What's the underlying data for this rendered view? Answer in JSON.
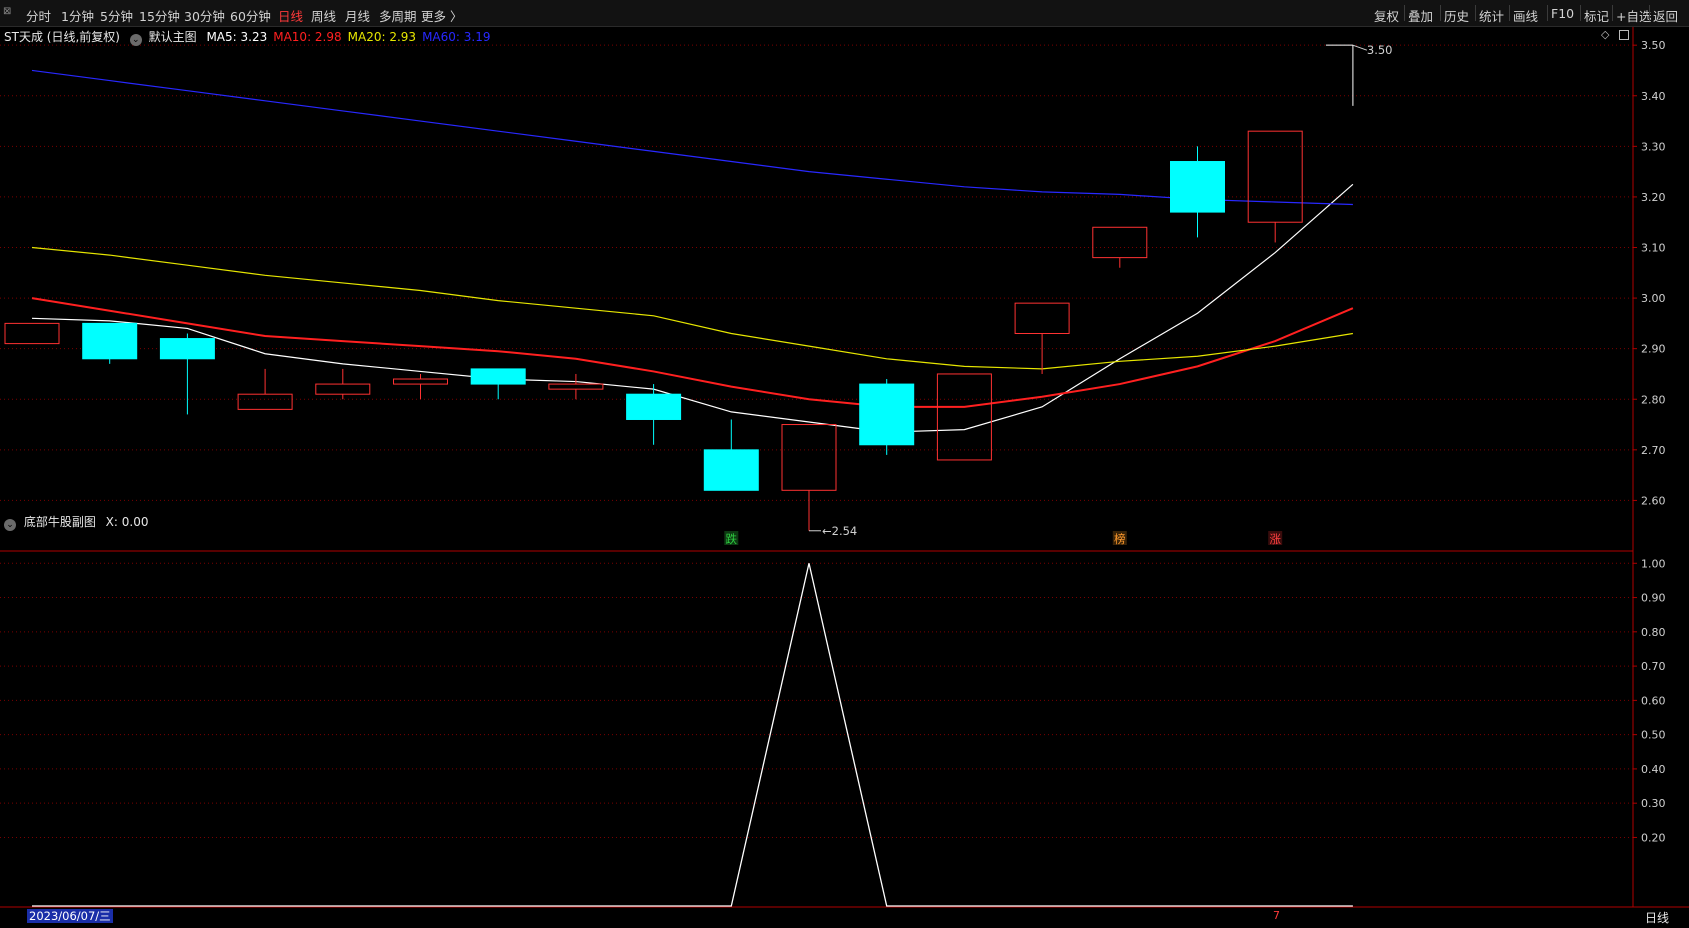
{
  "toolbar": {
    "left_items": [
      {
        "label": "分时",
        "active": false
      },
      {
        "label": "1分钟",
        "active": false
      },
      {
        "label": "5分钟",
        "active": false
      },
      {
        "label": "15分钟",
        "active": false
      },
      {
        "label": "30分钟",
        "active": false
      },
      {
        "label": "60分钟",
        "active": false
      },
      {
        "label": "日线",
        "active": true
      },
      {
        "label": "周线",
        "active": false
      },
      {
        "label": "月线",
        "active": false
      },
      {
        "label": "多周期",
        "active": false
      },
      {
        "label": "更多 〉",
        "active": false
      }
    ],
    "right_items": [
      "复权",
      "叠加",
      "历史",
      "统计",
      "画线",
      "F10",
      "标记",
      "+自选",
      "返回"
    ]
  },
  "main_chart": {
    "stock_title": "ST天成 (日线,前复权)",
    "template_label": "默认主图",
    "ma_legend": [
      {
        "label": "MA5: 3.23",
        "color": "#ffffff"
      },
      {
        "label": "MA10: 2.98",
        "color": "#ff2020"
      },
      {
        "label": "MA20: 2.93",
        "color": "#e6e600"
      },
      {
        "label": "MA60: 3.19",
        "color": "#2828ff"
      }
    ],
    "high_label": "3.50",
    "low_label": "2.54",
    "markers": [
      {
        "text": "跌",
        "color": "#2ecc40",
        "bg": "#0d3a12",
        "index": 9
      },
      {
        "text": "榜",
        "color": "#ff9a2e",
        "bg": "#3a2408",
        "index": 14
      },
      {
        "text": "涨",
        "color": "#ff4040",
        "bg": "#3a0c0c",
        "index": 16
      }
    ],
    "y_ticks": [
      "3.50",
      "3.40",
      "3.30",
      "3.20",
      "3.10",
      "3.00",
      "2.90",
      "2.80",
      "2.70",
      "2.60"
    ]
  },
  "chart_data": [
    {
      "type": "candlestick",
      "title": "ST天成 (日线,前复权)",
      "ylim": [
        2.5,
        3.53
      ],
      "candles": [
        {
          "o": 2.91,
          "h": 2.95,
          "l": 2.91,
          "c": 2.95
        },
        {
          "o": 2.95,
          "h": 2.95,
          "l": 2.87,
          "c": 2.88
        },
        {
          "o": 2.92,
          "h": 2.93,
          "l": 2.77,
          "c": 2.88
        },
        {
          "o": 2.78,
          "h": 2.86,
          "l": 2.78,
          "c": 2.81
        },
        {
          "o": 2.81,
          "h": 2.86,
          "l": 2.8,
          "c": 2.83
        },
        {
          "o": 2.83,
          "h": 2.85,
          "l": 2.8,
          "c": 2.84
        },
        {
          "o": 2.86,
          "h": 2.86,
          "l": 2.8,
          "c": 2.83
        },
        {
          "o": 2.82,
          "h": 2.85,
          "l": 2.8,
          "c": 2.83
        },
        {
          "o": 2.81,
          "h": 2.83,
          "l": 2.71,
          "c": 2.76
        },
        {
          "o": 2.7,
          "h": 2.76,
          "l": 2.62,
          "c": 2.62
        },
        {
          "o": 2.62,
          "h": 2.75,
          "l": 2.54,
          "c": 2.75
        },
        {
          "o": 2.83,
          "h": 2.84,
          "l": 2.69,
          "c": 2.71
        },
        {
          "o": 2.68,
          "h": 2.85,
          "l": 2.68,
          "c": 2.85
        },
        {
          "o": 2.93,
          "h": 2.99,
          "l": 2.85,
          "c": 2.99
        },
        {
          "o": 3.08,
          "h": 3.14,
          "l": 3.06,
          "c": 3.14
        },
        {
          "o": 3.27,
          "h": 3.3,
          "l": 3.12,
          "c": 3.17
        },
        {
          "o": 3.15,
          "h": 3.33,
          "l": 3.11,
          "c": 3.33
        },
        {
          "o": 3.38,
          "h": 3.5,
          "l": 3.38,
          "c": 3.5
        }
      ],
      "series": [
        {
          "name": "MA5",
          "color": "#ffffff",
          "values": [
            2.96,
            2.955,
            2.94,
            2.89,
            2.87,
            2.855,
            2.84,
            2.835,
            2.82,
            2.775,
            2.755,
            2.735,
            2.74,
            2.785,
            2.88,
            2.97,
            3.09,
            3.225
          ]
        },
        {
          "name": "MA10",
          "color": "#ff2020",
          "values": [
            3.0,
            2.975,
            2.95,
            2.925,
            2.915,
            2.905,
            2.895,
            2.88,
            2.855,
            2.825,
            2.8,
            2.785,
            2.785,
            2.805,
            2.83,
            2.865,
            2.915,
            2.98
          ]
        },
        {
          "name": "MA20",
          "color": "#e6e600",
          "values": [
            3.1,
            3.085,
            3.065,
            3.045,
            3.03,
            3.015,
            2.995,
            2.98,
            2.965,
            2.93,
            2.905,
            2.88,
            2.865,
            2.86,
            2.875,
            2.885,
            2.905,
            2.93
          ]
        },
        {
          "name": "MA60",
          "color": "#2828ff",
          "values": [
            3.45,
            3.43,
            3.41,
            3.39,
            3.37,
            3.35,
            3.33,
            3.31,
            3.29,
            3.27,
            3.25,
            3.235,
            3.22,
            3.21,
            3.205,
            3.195,
            3.19,
            3.185
          ]
        }
      ]
    },
    {
      "type": "line",
      "title": "底部牛股副图",
      "ylim": [
        0.0,
        1.03
      ],
      "series": [
        {
          "name": "X",
          "color": "#ffffff",
          "values": [
            0,
            0,
            0,
            0,
            0,
            0,
            0,
            0,
            0,
            0,
            1,
            0,
            0,
            0,
            0,
            0,
            0,
            0
          ]
        }
      ]
    }
  ],
  "sub_chart": {
    "title": "底部牛股副图",
    "value_label": "X: 0.00",
    "y_ticks": [
      "1.00",
      "0.90",
      "0.80",
      "0.70",
      "0.60",
      "0.50",
      "0.40",
      "0.30",
      "0.20"
    ]
  },
  "bottom": {
    "date_label": "2023/06/07/三",
    "mark_label": "7",
    "period_label": "日线"
  },
  "colors": {
    "up": "#ff3232",
    "down": "#00ffff",
    "grid": "#7a0000",
    "border": "#b00000",
    "axis_text": "#d0d0d0"
  }
}
